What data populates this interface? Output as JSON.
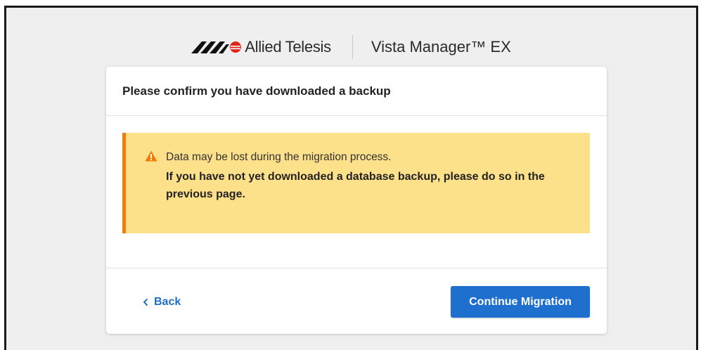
{
  "brand": {
    "company_name": "Allied Telesis",
    "product_name": "Vista Manager™ EX"
  },
  "dialog": {
    "title": "Please confirm you have downloaded a backup",
    "warning": {
      "icon": "warning-triangle-icon",
      "line1": "Data may be lost during the migration process.",
      "line2": "If you have not yet downloaded a database backup, please do so in the previous page."
    },
    "back_label": "Back",
    "continue_label": "Continue Migration"
  },
  "colors": {
    "primary_button": "#1f6fce",
    "link": "#1f6fc8",
    "warning_bg": "#fde08a",
    "warning_accent": "#f37b06"
  }
}
